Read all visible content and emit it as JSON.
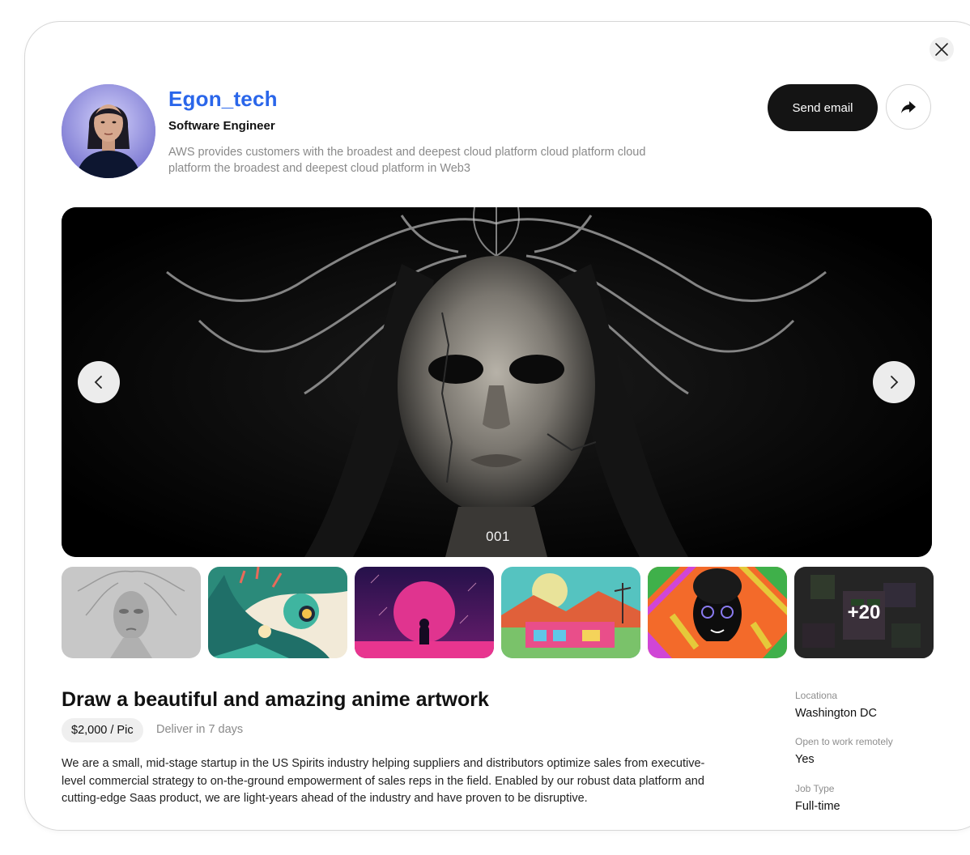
{
  "profile": {
    "name": "Egon_tech",
    "role": "Software Engineer",
    "bio": "AWS provides customers with the broadest and deepest cloud platform cloud platform cloud platform the broadest and deepest cloud platform in Web3"
  },
  "actions": {
    "send_email_label": "Send email"
  },
  "gallery": {
    "counter": "001",
    "more_label": "+20",
    "thumbnails": [
      "mask-portrait",
      "teal-diver",
      "pink-planet-astronaut",
      "desert-house",
      "patterned-portrait",
      "more"
    ]
  },
  "listing": {
    "title": "Draw a beautiful and amazing anime artwork",
    "price": "$2,000 / Pic",
    "delivery": "Deliver in 7 days",
    "description": "We are a small, mid-stage startup in the US Spirits industry helping suppliers and distributors optimize sales from executive-level commercial strategy to on-the-ground empowerment of sales reps in the field. Enabled by our robust data platform and cutting-edge Saas product, we are light-years ahead of the industry and have proven to be disruptive."
  },
  "details": {
    "location_label": "Locationa",
    "location_value": "Washington DC",
    "remote_label": "Open to work remotely",
    "remote_value": "Yes",
    "jobtype_label": "Job Type",
    "jobtype_value": "Full-time"
  },
  "colors": {
    "accent": "#2a66ea",
    "button_dark": "#141414",
    "muted_text": "#8a8a8a"
  }
}
